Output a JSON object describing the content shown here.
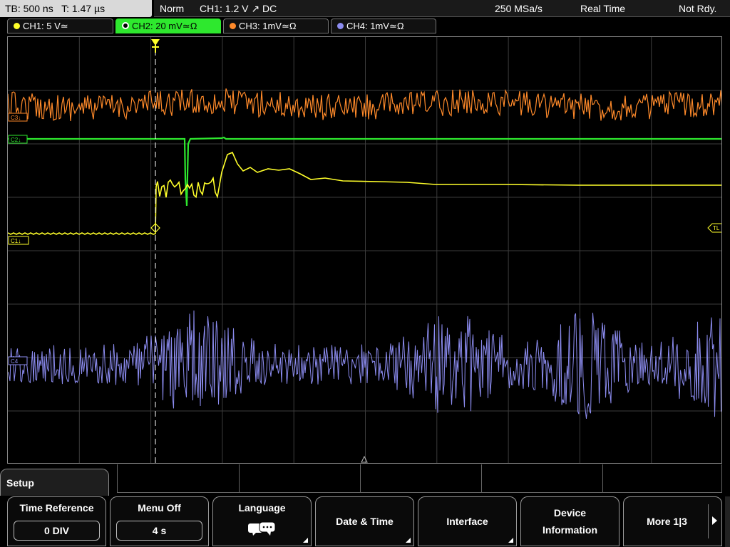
{
  "status": {
    "timebase": "TB: 500 ns   T: 1.47 µs",
    "trigger_mode": "Norm",
    "trigger_info": "CH1: 1.2 V ↗ DC",
    "sample_rate": "250 MSa/s",
    "acq_mode": "Real Time",
    "state": "Not Rdy."
  },
  "channels": [
    {
      "label": "CH1: 5 V≃",
      "color": "#ffff2a",
      "active": false
    },
    {
      "label": "CH2: 20 mV≃Ω",
      "color": "#2ee82e",
      "active": true
    },
    {
      "label": "CH3: 1mV≃Ω",
      "color": "#ff8a2a",
      "active": false
    },
    {
      "label": "CH4: 1mV≃Ω",
      "color": "#8c8cf0",
      "active": false
    }
  ],
  "markers": {
    "ch1": "C1↓",
    "ch2": "C2↓",
    "ch3": "C3↓",
    "ch4": "C4",
    "trigger_level": "TL"
  },
  "colors": {
    "ch1": "#ffff2a",
    "ch2": "#2ee82e",
    "ch3": "#ff8a2a",
    "ch4": "#8c8cf0",
    "grid": "#3c3c3c",
    "trigger_marker": "#ffff2a"
  },
  "menu": {
    "tab": "Setup",
    "softkeys": [
      {
        "title": "Time Reference",
        "value": "0 DIV"
      },
      {
        "title": "Menu Off",
        "value": "4 s"
      },
      {
        "title": "Language",
        "icon": "speech-bubbles-icon"
      },
      {
        "title": "Date & Time"
      },
      {
        "title": "Interface"
      },
      {
        "title_line1": "Device",
        "title_line2": "Information"
      },
      {
        "title": "More 1|3"
      }
    ]
  }
}
